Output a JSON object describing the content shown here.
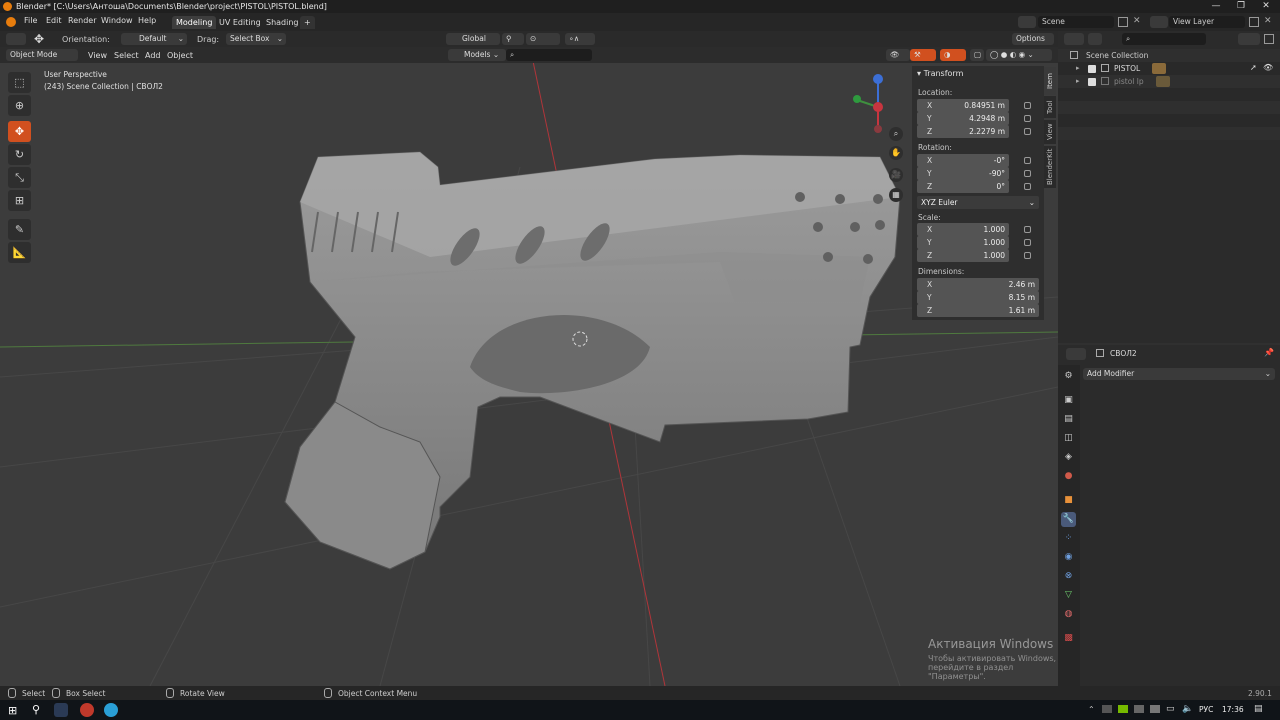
{
  "window": {
    "title": "Blender* [C:\\Users\\Антоша\\Documents\\Blender\\project\\PISTOL\\PISTOL.blend]"
  },
  "menu": [
    "File",
    "Edit",
    "Render",
    "Window",
    "Help"
  ],
  "workspaces": [
    "Modeling",
    "UV Editing",
    "Shading"
  ],
  "scene": {
    "name": "Scene",
    "view_layer": "View Layer"
  },
  "header": {
    "orientation_label": "Orientation:",
    "orientation": "Default",
    "drag_label": "Drag:",
    "drag": "Select Box",
    "transform_orientation": "Global",
    "options": "Options",
    "mode": "Object Mode",
    "menus": [
      "View",
      "Select",
      "Add",
      "Object"
    ],
    "collection_filter": "Models"
  },
  "viewport": {
    "perspective": "User Perspective",
    "collection_info": "(243) Scene Collection | СВОЛ2"
  },
  "npanel": {
    "title": "Transform",
    "tabs": [
      "Item",
      "Tool",
      "View",
      "BlenderKit"
    ],
    "location_label": "Location:",
    "location": [
      {
        "axis": "X",
        "value": "0.84951 m"
      },
      {
        "axis": "Y",
        "value": "4.2948 m"
      },
      {
        "axis": "Z",
        "value": "2.2279 m"
      }
    ],
    "rotation_label": "Rotation:",
    "rotation": [
      {
        "axis": "X",
        "value": "-0°"
      },
      {
        "axis": "Y",
        "value": "-90°"
      },
      {
        "axis": "Z",
        "value": "0°"
      }
    ],
    "rotation_mode": "XYZ Euler",
    "scale_label": "Scale:",
    "scale": [
      {
        "axis": "X",
        "value": "1.000"
      },
      {
        "axis": "Y",
        "value": "1.000"
      },
      {
        "axis": "Z",
        "value": "1.000"
      }
    ],
    "dimensions_label": "Dimensions:",
    "dimensions": [
      {
        "axis": "X",
        "value": "2.46 m"
      },
      {
        "axis": "Y",
        "value": "8.15 m"
      },
      {
        "axis": "Z",
        "value": "1.61 m"
      }
    ]
  },
  "outliner": {
    "root": "Scene Collection",
    "items": [
      "PISTOL",
      "pistol lp"
    ]
  },
  "properties": {
    "object": "СВОЛ2",
    "add_modifier": "Add Modifier"
  },
  "statusbar": {
    "select": "Select",
    "box_select": "Box Select",
    "rotate_view": "Rotate View",
    "context_menu": "Object Context Menu",
    "version": "2.90.1"
  },
  "activation": {
    "title": "Активация Windows",
    "subtitle": "Чтобы активировать Windows, перейдите в раздел \"Параметры\"."
  },
  "taskbar": {
    "lang": "РУС",
    "time": "17:36"
  },
  "colors": {
    "accent": "#d1501f",
    "orange_logo": "#e87d0d",
    "axis_red": "#c8353f",
    "axis_green": "#3f8f3f"
  }
}
